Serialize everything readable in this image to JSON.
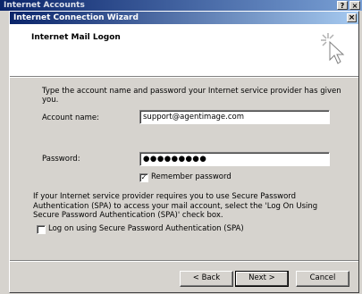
{
  "background_window": {
    "title": "Internet Accounts",
    "help_glyph": "?",
    "close_glyph": "×"
  },
  "dialog": {
    "title": "Internet Connection Wizard",
    "close_glyph": "×",
    "header_title": "Internet Mail Logon",
    "instruction": "Type the account name and password your Internet service provider has given you.",
    "account_label": "Account name:",
    "account_value": "support@agentimage.com",
    "password_label": "Password:",
    "password_value": "●●●●●●●●●",
    "remember_label": "Remember password",
    "remember_checked_glyph": "✓",
    "spa_description": "If your Internet service provider requires you to use Secure Password Authentication (SPA) to access your mail account, select the 'Log On Using Secure Password Authentication (SPA)' check box.",
    "spa_label": "Log on using Secure Password Authentication (SPA)",
    "buttons": {
      "back": "< Back",
      "next": "Next >",
      "cancel": "Cancel"
    }
  },
  "icons": {
    "wizard": "wizard-cursor-icon"
  },
  "colors": {
    "title_bar_start": "#0a246a",
    "title_bar_end": "#a6caf0",
    "dialog_face": "#d6d3ce"
  }
}
